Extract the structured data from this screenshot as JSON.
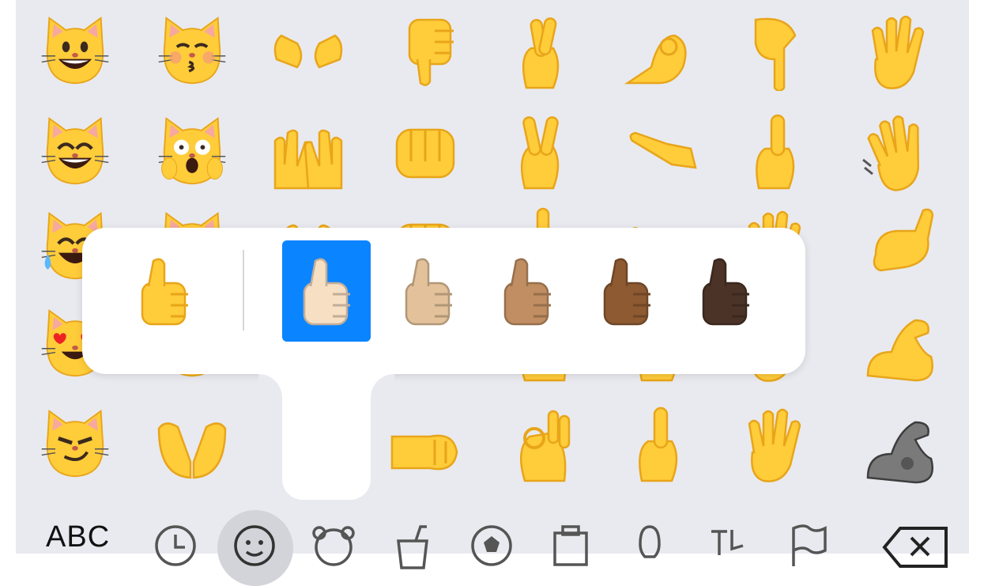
{
  "keyboard": {
    "category_label": "ABC",
    "categories": [
      "recent-icon",
      "smileys-icon",
      "animals-icon",
      "food-icon",
      "activity-icon",
      "travel-icon",
      "objects-icon",
      "symbols-icon",
      "flags-icon"
    ],
    "selected_category": "smileys-icon"
  },
  "emoji_grid": [
    [
      "grinning-cat",
      "kissing-cat",
      "open-hands",
      "thumbs-down",
      "crossed-fingers",
      "pinched-fingers",
      "backhand-index-down",
      "vulcan-salute"
    ],
    [
      "grinning-cat-smiling-eyes",
      "weary-cat",
      "raising-hands",
      "oncoming-fist",
      "victory-hand",
      "leftwards-hand",
      "index-pointing-up",
      "waving-hand"
    ],
    [
      "cat-tears-of-joy",
      "smiling-cat-heart-eyes",
      "raising-hands-sparkle",
      "raised-fist",
      "middle-finger",
      "pointing-hand",
      "raised-hand",
      "call-me-hand"
    ],
    [
      "cat-heart-eyes",
      "cat-smile",
      "palms-up",
      "left-fist",
      "ok-hand",
      "index-pointing-up-2",
      "hand-splayed",
      "flexed-biceps"
    ],
    [
      "smirk-cat",
      "palms-up-together",
      "",
      "left-facing-fist",
      "ok-hand-2",
      "index-up",
      "raised-hand-splayed",
      "mechanical-arm"
    ]
  ],
  "skin_popup": {
    "base": "thumbs-up-yellow",
    "tones": [
      "light",
      "medium-light",
      "medium",
      "medium-dark",
      "dark"
    ],
    "selected_tone": "light"
  },
  "colors": {
    "keyboard_bg": "#e9eaef",
    "emoji_yellow": "#ffcc3a",
    "selection_blue": "#0b84ff",
    "tone_light": "#f7dfc4",
    "tone_medium_light": "#e3c19a",
    "tone_medium": "#c08e62",
    "tone_medium_dark": "#8d5a32",
    "tone_dark": "#4b3327"
  }
}
